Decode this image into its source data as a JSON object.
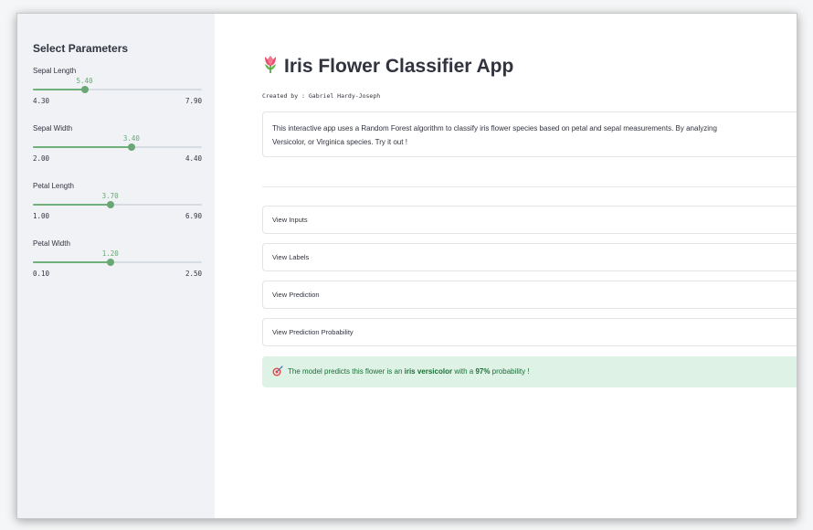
{
  "sidebar": {
    "title": "Select Parameters",
    "sliders": [
      {
        "label": "Sepal Length",
        "value": "5.40",
        "min": "4.30",
        "max": "7.90",
        "min_num": 4.3,
        "max_num": 7.9,
        "value_num": 5.4
      },
      {
        "label": "Sepal Width",
        "value": "3.40",
        "min": "2.00",
        "max": "4.40",
        "min_num": 2.0,
        "max_num": 4.4,
        "value_num": 3.4
      },
      {
        "label": "Petal Length",
        "value": "3.70",
        "min": "1.00",
        "max": "6.90",
        "min_num": 1.0,
        "max_num": 6.9,
        "value_num": 3.7
      },
      {
        "label": "Petal Width",
        "value": "1.20",
        "min": "0.10",
        "max": "2.50",
        "min_num": 0.1,
        "max_num": 2.5,
        "value_num": 1.2
      }
    ]
  },
  "main": {
    "title": "Iris Flower Classifier App",
    "title_icon": "tulip-icon",
    "created_by": "Created by : Gabriel Hardy-Joseph",
    "description_line1": "This interactive app uses a Random Forest algorithm to classify iris flower species based on petal and sepal measurements. By analyzing",
    "description_line2": "Versicolor, or Virginica species. Try it out !",
    "expanders": [
      "View Inputs",
      "View Labels",
      "View Prediction",
      "View Prediction Probability"
    ],
    "result": {
      "prefix": "The model predicts this flower is an ",
      "species": "iris versicolor",
      "middle": " with a ",
      "probability": "97%",
      "suffix": " probability !",
      "icon": "target-icon"
    }
  },
  "colors": {
    "accent": "#6aa775",
    "sidebar_bg": "#f0f2f6",
    "success_bg": "#dff2e6",
    "success_text": "#1b6e37"
  }
}
